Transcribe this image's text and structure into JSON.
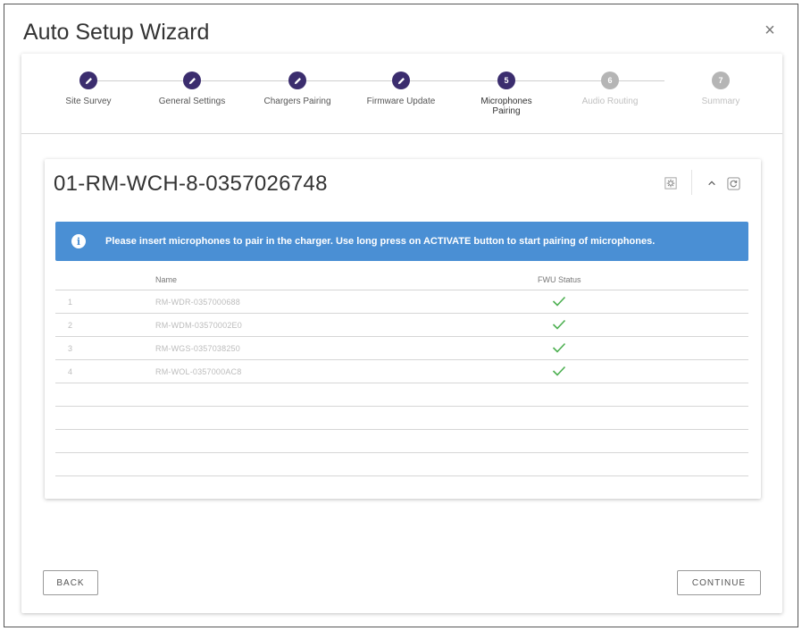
{
  "dialog": {
    "title": "Auto Setup Wizard",
    "close_label": "×"
  },
  "stepper": {
    "steps": [
      {
        "label": "Site Survey",
        "state": "done",
        "number": "1"
      },
      {
        "label": "General Settings",
        "state": "done",
        "number": "2"
      },
      {
        "label": "Chargers Pairing",
        "state": "done",
        "number": "3"
      },
      {
        "label": "Firmware Update",
        "state": "done",
        "number": "4"
      },
      {
        "label": "Microphones Pairing",
        "state": "active",
        "number": "5"
      },
      {
        "label": "Audio Routing",
        "state": "inactive",
        "number": "6"
      },
      {
        "label": "Summary",
        "state": "inactive",
        "number": "7"
      }
    ]
  },
  "device": {
    "title": "01-RM-WCH-8-0357026748",
    "icons": [
      "brightness-icon",
      "chevron-up-icon",
      "refresh-icon"
    ]
  },
  "info": {
    "text": "Please insert microphones to pair in the charger. Use long press on ACTIVATE button to start pairing of microphones."
  },
  "table": {
    "columns": {
      "name": "Name",
      "status": "FWU Status"
    },
    "rows": [
      {
        "index": "1",
        "name": "RM-WDR-0357000688",
        "status": "ok"
      },
      {
        "index": "2",
        "name": "RM-WDM-03570002E0",
        "status": "ok"
      },
      {
        "index": "3",
        "name": "RM-WGS-0357038250",
        "status": "ok"
      },
      {
        "index": "4",
        "name": "RM-WOL-0357000AC8",
        "status": "ok"
      }
    ]
  },
  "buttons": {
    "back": "BACK",
    "continue": "CONTINUE"
  },
  "colors": {
    "step_done": "#3b2d6e",
    "step_inactive": "#b5b5b5",
    "banner": "#4a8fd4",
    "check": "#4caf50"
  }
}
